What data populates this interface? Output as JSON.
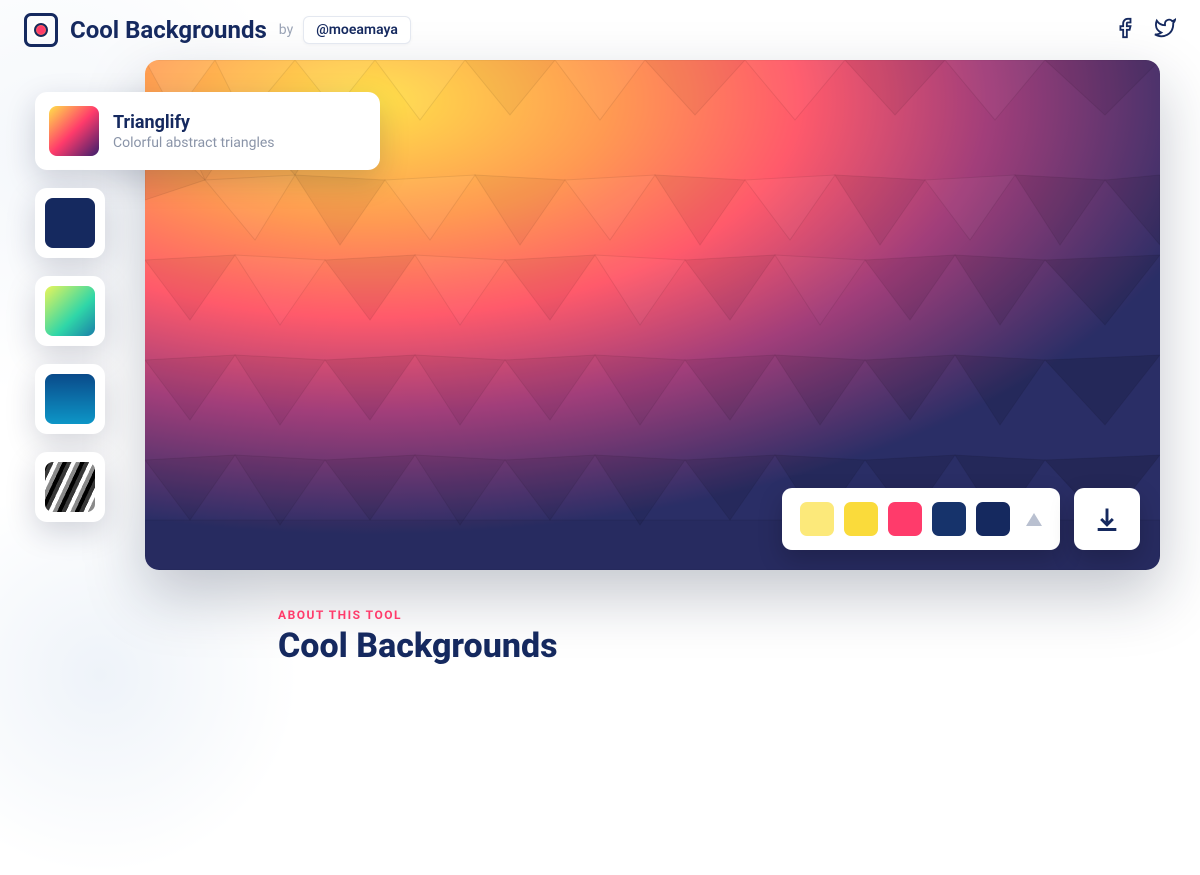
{
  "header": {
    "brand": "Cool Backgrounds",
    "by": "by",
    "author": "@moeamaya"
  },
  "sidebar": {
    "active": {
      "name": "trianglify",
      "title": "Trianglify",
      "subtitle": "Colorful abstract triangles"
    },
    "items": [
      {
        "name": "solid-dark"
      },
      {
        "name": "teal-yellow"
      },
      {
        "name": "blue-grad"
      },
      {
        "name": "mono"
      }
    ]
  },
  "palette": {
    "colors": [
      "#fce97a",
      "#fadb3b",
      "#ff3b6b",
      "#16336b",
      "#15295f"
    ]
  },
  "about": {
    "eyebrow": "ABOUT THIS TOOL",
    "heading": "Cool Backgrounds"
  },
  "icons": {
    "facebook": "facebook-icon",
    "twitter": "twitter-icon",
    "download": "download-icon"
  }
}
